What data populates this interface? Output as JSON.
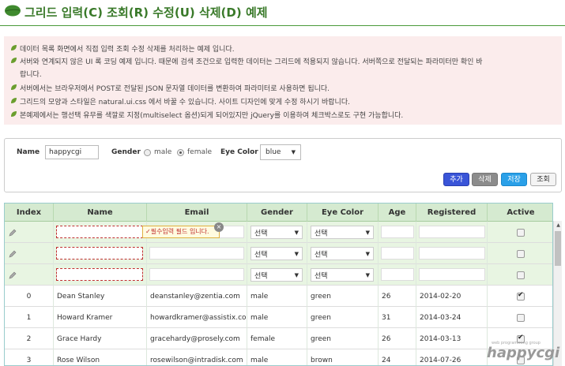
{
  "title": "그리드 입력(C) 조회(R) 수정(U) 삭제(D) 예제",
  "notice": [
    "데이터 목록 화면에서 직접 입력 조회 수정 삭제를 처리하는 예제 입니다.",
    "서버와 연계되지 않은 UI 록 코딩 예제 입니다. 때문에 검색 조건으로 입력한 데이터는 그리드에 적용되지 않습니다. 서버쪽으로 전달되는 파라미터만 확인 바",
    "랍니다.",
    "서버에서는 브라우저에서 POST로 전달된 JSON 문자열 데이터를 변환하여 파라미터로 사용하면 됩니다.",
    "그리드의 모양과 스타일은 natural.ui.css 에서 바꿀 수 있습니다. 사이트 디자인에 맞게 수정 하시기 바랍니다.",
    "본예제에서는 행선택 유무를 색깔로 지정(multiselect 옵션)되게 되어있지만 jQuery를 이용하여 체크박스로도 구현 가능합니다."
  ],
  "search": {
    "name_label": "Name",
    "name_value": "happycgi",
    "gender_label": "Gender",
    "gender_male": "male",
    "gender_female": "female",
    "eye_label": "Eye Color",
    "eye_value": "blue"
  },
  "buttons": {
    "add": "추가",
    "delete": "삭제",
    "save": "저장",
    "search": "조회"
  },
  "grid": {
    "headers": [
      "Index",
      "Name",
      "Email",
      "Gender",
      "Eye Color",
      "Age",
      "Registered",
      "Active"
    ],
    "select_placeholder": "선택",
    "tooltip": "✓필수입력 필드 입니다.",
    "tip_close": "×",
    "rows": [
      {
        "index": "0",
        "name": "Dean Stanley",
        "email": "deanstanley@zentia.com",
        "gender": "male",
        "eye": "green",
        "age": "26",
        "registered": "2014-02-20",
        "active": true
      },
      {
        "index": "1",
        "name": "Howard Kramer",
        "email": "howardkramer@assistix.co",
        "gender": "male",
        "eye": "green",
        "age": "31",
        "registered": "2014-03-24",
        "active": false
      },
      {
        "index": "2",
        "name": "Grace Hardy",
        "email": "gracehardy@prosely.com",
        "gender": "female",
        "eye": "green",
        "age": "26",
        "registered": "2014-03-13",
        "active": true
      },
      {
        "index": "3",
        "name": "Rose Wilson",
        "email": "rosewilson@intradisk.com",
        "gender": "male",
        "eye": "brown",
        "age": "24",
        "registered": "2014-07-26",
        "active": false
      }
    ]
  },
  "watermark": {
    "small": "web programming group",
    "big": "happycgi"
  },
  "colors": {
    "title": "#3a7a2a",
    "header_bg": "#d5ead0",
    "new_row_bg": "#e8f5e2",
    "notice_bg": "#fbecec"
  }
}
